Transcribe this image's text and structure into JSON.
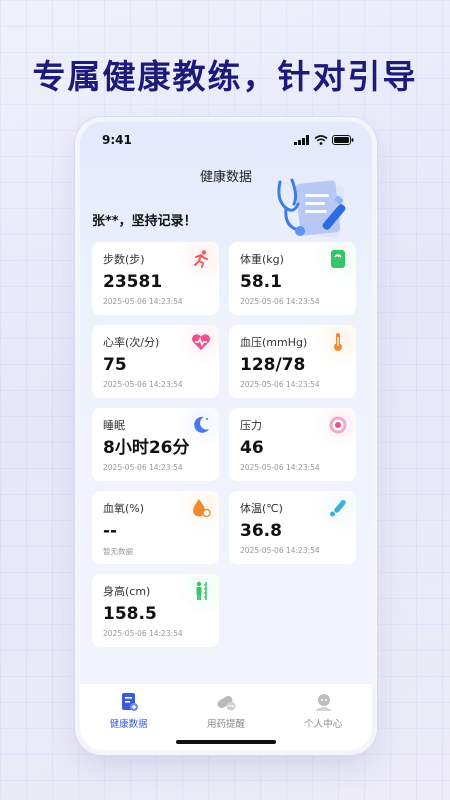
{
  "headline": "专属健康教练，针对引导",
  "status_bar": {
    "time": "9:41"
  },
  "nav_title": "健康数据",
  "greeting": "张**，坚持记录！",
  "cards": [
    {
      "id": "steps",
      "label": "步数(步)",
      "value": "23581",
      "time": "2025-05-06 14:23:54",
      "icon": "running-icon",
      "color": "#f25c5c"
    },
    {
      "id": "weight",
      "label": "体重(kg)",
      "value": "58.1",
      "time": "2025-05-06 14:23:54",
      "icon": "scale-icon",
      "color": "#35c46a"
    },
    {
      "id": "heart-rate",
      "label": "心率(次/分)",
      "value": "75",
      "time": "2025-05-06 14:23:54",
      "icon": "heart-icon",
      "color": "#f0508a"
    },
    {
      "id": "blood-pressure",
      "label": "血压(mmHg)",
      "value": "128/78",
      "time": "2025-05-06 14:23:54",
      "icon": "thermometer-icon",
      "color": "#f08a2a"
    },
    {
      "id": "sleep",
      "label": "睡眠",
      "value": "8小时26分",
      "time": "2025-05-06 14:23:54",
      "icon": "moon-icon",
      "color": "#4a78e6"
    },
    {
      "id": "stress",
      "label": "压力",
      "value": "46",
      "time": "2025-05-06 14:23:54",
      "icon": "target-icon",
      "color": "#e8508f"
    },
    {
      "id": "blood-oxygen",
      "label": "血氧(%)",
      "value": "--",
      "time": "暂无数据",
      "icon": "oxygen-drop-icon",
      "color": "#f08a2a"
    },
    {
      "id": "temperature",
      "label": "体温(℃)",
      "value": "36.8",
      "time": "2025-05-06 14:23:54",
      "icon": "thermometer-pen-icon",
      "color": "#3aaee0"
    },
    {
      "id": "height",
      "label": "身高(cm)",
      "value": "158.5",
      "time": "2025-05-06 14:23:54",
      "icon": "height-ruler-icon",
      "color": "#35c46a"
    }
  ],
  "tabs": [
    {
      "label": "健康数据",
      "icon": "health-data-icon",
      "active": true
    },
    {
      "label": "用药提醒",
      "icon": "pill-icon",
      "active": false
    },
    {
      "label": "个人中心",
      "icon": "user-icon",
      "active": false
    }
  ],
  "colors": {
    "headline": "#1d1a7a",
    "accent": "#3d5bd9",
    "inactive": "#8a8a8a"
  }
}
